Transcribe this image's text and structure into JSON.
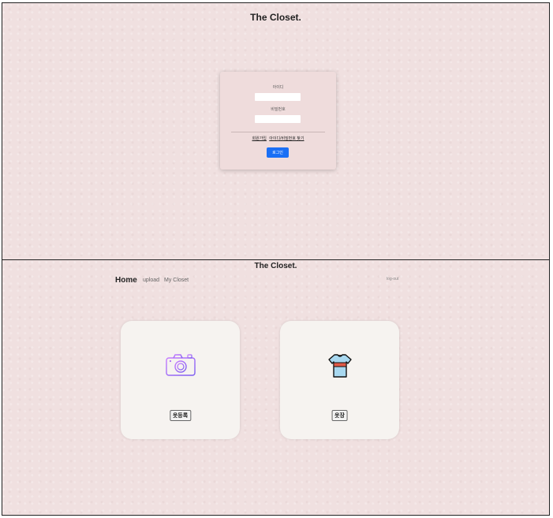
{
  "site_title": "The Closet.",
  "login": {
    "id_label": "아이디",
    "pw_label": "비밀번호",
    "id_value": "",
    "pw_value": "",
    "signup_link": "회원가입",
    "find_link": "아이디/비밀번호 찾기",
    "submit_label": "로그인"
  },
  "nav": {
    "home": "Home",
    "upload": "upload",
    "my_closet": "My Closet",
    "logout": "log-out"
  },
  "tiles": [
    {
      "icon": "camera-icon",
      "button_label": "옷등록"
    },
    {
      "icon": "tshirt-icon",
      "button_label": "옷장"
    }
  ],
  "colors": {
    "background": "#f0e0e0",
    "primary_button": "#1a6ff5",
    "tile_background": "#f6f3f0"
  }
}
